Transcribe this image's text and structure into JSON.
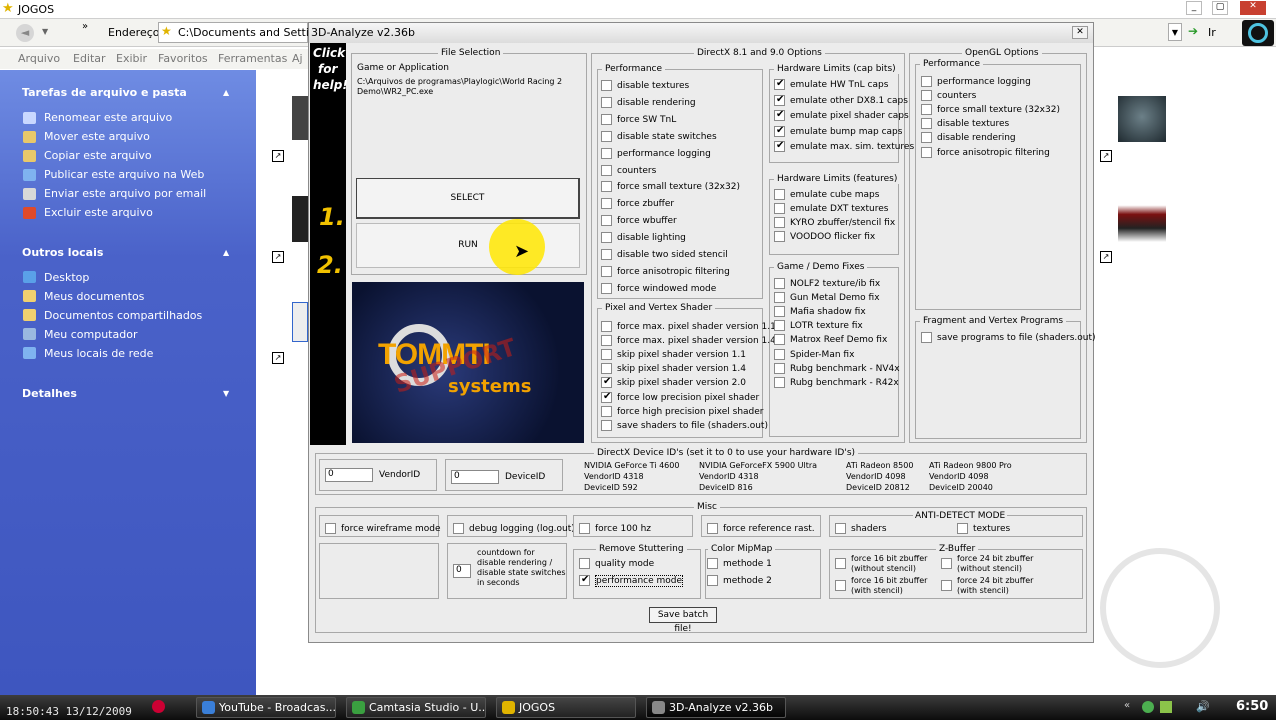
{
  "explorer": {
    "title": "JOGOS",
    "address_label": "Endereço",
    "address_value": "C:\\Documents and Setting",
    "go_label": "Ir",
    "menu": [
      "Arquivo",
      "Editar",
      "Exibir",
      "Favoritos",
      "Ferramentas",
      "Aj"
    ],
    "sidebar": {
      "tasks_title": "Tarefas de arquivo e pasta",
      "tasks": [
        "Renomear este arquivo",
        "Mover este arquivo",
        "Copiar este arquivo",
        "Publicar este arquivo na Web",
        "Enviar este arquivo por email",
        "Excluir este arquivo"
      ],
      "places_title": "Outros locais",
      "places": [
        "Desktop",
        "Meus documentos",
        "Documentos compartilhados",
        "Meu computador",
        "Meus locais de rede"
      ],
      "details_title": "Detalhes"
    }
  },
  "dialog": {
    "title": "3D-Analyze v2.36b",
    "help_text": [
      "Click",
      "for",
      "help!"
    ],
    "step1": "1.",
    "step2": "2.",
    "file_selection": {
      "title": "File Selection",
      "label": "Game or Application",
      "path": "C:\\Arquivos de programas\\Playlogic\\World Racing 2 Demo\\WR2_PC.exe",
      "select_button": "SELECT",
      "run_button": "RUN"
    },
    "logo": {
      "brand": "TOMMTI",
      "sub": "systems",
      "stamp": "SUPPORT"
    },
    "directx": {
      "title": "DirectX 8.1 and 9.0 Options",
      "performance": {
        "title": "Performance",
        "items": [
          {
            "label": "disable textures",
            "checked": false
          },
          {
            "label": "disable rendering",
            "checked": false
          },
          {
            "label": "force SW TnL",
            "checked": false
          },
          {
            "label": "disable state switches",
            "checked": false
          },
          {
            "label": "performance logging",
            "checked": false
          },
          {
            "label": "counters",
            "checked": false
          },
          {
            "label": "force small texture (32x32)",
            "checked": false
          },
          {
            "label": "force zbuffer",
            "checked": false
          },
          {
            "label": "force wbuffer",
            "checked": false
          },
          {
            "label": "disable lighting",
            "checked": false
          },
          {
            "label": "disable two sided stencil",
            "checked": false
          },
          {
            "label": "force anisotropic filtering",
            "checked": false
          },
          {
            "label": "force windowed mode",
            "checked": false
          }
        ]
      },
      "pixel_vertex": {
        "title": "Pixel and Vertex Shader",
        "items": [
          {
            "label": "force max. pixel shader version 1.1",
            "checked": false
          },
          {
            "label": "force max. pixel shader version 1.4",
            "checked": false
          },
          {
            "label": "skip pixel shader version 1.1",
            "checked": false
          },
          {
            "label": "skip pixel shader version 1.4",
            "checked": false
          },
          {
            "label": "skip pixel shader version 2.0",
            "checked": true
          },
          {
            "label": "force low precision pixel shader",
            "checked": true
          },
          {
            "label": "force high precision pixel shader",
            "checked": false
          },
          {
            "label": "save shaders to file (shaders.out)",
            "checked": false
          }
        ]
      },
      "caps": {
        "title": "Hardware Limits (cap bits)",
        "items": [
          {
            "label": "emulate HW TnL caps",
            "checked": true
          },
          {
            "label": "emulate other DX8.1 caps",
            "checked": true
          },
          {
            "label": "emulate pixel shader caps",
            "checked": true
          },
          {
            "label": "emulate bump map caps",
            "checked": true
          },
          {
            "label": "emulate max. sim. textures",
            "checked": true
          }
        ]
      },
      "features": {
        "title": "Hardware Limits (features)",
        "items": [
          {
            "label": "emulate cube maps",
            "checked": false
          },
          {
            "label": "emulate DXT textures",
            "checked": false
          },
          {
            "label": "KYRO zbuffer/stencil fix",
            "checked": false
          },
          {
            "label": "VOODOO flicker fix",
            "checked": false
          }
        ]
      },
      "fixes": {
        "title": "Game / Demo Fixes",
        "items": [
          {
            "label": "NOLF2 texture/ib fix",
            "checked": false
          },
          {
            "label": "Gun Metal Demo fix",
            "checked": false
          },
          {
            "label": "Mafia shadow fix",
            "checked": false
          },
          {
            "label": "LOTR texture fix",
            "checked": false
          },
          {
            "label": "Matrox Reef Demo fix",
            "checked": false
          },
          {
            "label": "Spider-Man fix",
            "checked": false
          },
          {
            "label": "Rubg benchmark - NV4x",
            "checked": false
          },
          {
            "label": "Rubg benchmark - R42x",
            "checked": false
          }
        ]
      }
    },
    "opengl": {
      "title": "OpenGL Options",
      "performance": {
        "title": "Performance",
        "items": [
          {
            "label": "performance logging",
            "checked": false
          },
          {
            "label": "counters",
            "checked": false
          },
          {
            "label": "force small texture (32x32)",
            "checked": false
          },
          {
            "label": "disable textures",
            "checked": false
          },
          {
            "label": "disable rendering",
            "checked": false
          },
          {
            "label": "force anisotropic filtering",
            "checked": false
          }
        ]
      },
      "fvp": {
        "title": "Fragment and Vertex Programs",
        "items": [
          {
            "label": "save programs to file (shaders.out)",
            "checked": false
          }
        ]
      }
    },
    "device_ids": {
      "title": "DirectX Device ID's (set it to 0 to use your hardware ID's)",
      "vendor_value": "0",
      "vendor_label": "VendorID",
      "device_value": "0",
      "device_label": "DeviceID",
      "cards": [
        {
          "name": "NVIDIA GeForce Ti 4600",
          "vendor": "VendorID 4318",
          "device": "DeviceID 592"
        },
        {
          "name": "NVIDIA GeForceFX 5900 Ultra",
          "vendor": "VendorID 4318",
          "device": "DeviceID 816"
        },
        {
          "name": "ATi Radeon 8500",
          "vendor": "VendorID 4098",
          "device": "DeviceID 20812"
        },
        {
          "name": "ATi Radeon 9800 Pro",
          "vendor": "VendorID 4098",
          "device": "DeviceID 20040"
        }
      ]
    },
    "misc": {
      "title": "Misc",
      "force_wireframe": "force wireframe mode",
      "debug_logging": "debug logging (log.out)",
      "force_100hz": "force 100 hz",
      "force_reference": "force reference rast.",
      "anti_detect_title": "ANTI-DETECT MODE",
      "shaders": "shaders",
      "textures": "textures",
      "countdown_value": "0",
      "countdown_label": [
        "countdown for",
        "disable rendering /",
        "disable state switches",
        "in seconds"
      ],
      "stutter_title": "Remove Stuttering",
      "quality_mode": {
        "label": "quality mode",
        "checked": false
      },
      "performance_mode": {
        "label": "performance mode",
        "checked": true
      },
      "mipmap_title": "Color MipMap",
      "methode1": "methode 1",
      "methode2": "methode 2",
      "zbuffer_title": "Z-Buffer",
      "z16_nostencil": [
        "force 16 bit zbuffer",
        "(without stencil)"
      ],
      "z16_stencil": [
        "force 16 bit zbuffer",
        "(with stencil)"
      ],
      "z24_nostencil": [
        "force 24 bit zbuffer",
        "(without stencil)"
      ],
      "z24_stencil": [
        "force 24 bit zbuffer",
        "(with stencil)"
      ],
      "save_batch": "Save batch file!"
    }
  },
  "taskbar": {
    "timestamp": "18:50:43 13/12/2009",
    "buttons": [
      "YouTube - Broadcas...",
      "Camtasia Studio - U...",
      "JOGOS",
      "3D-Analyze v2.36b"
    ],
    "clock": "6:50"
  },
  "colors": {
    "sidebar": "#4a62c9",
    "step_numbers": "#f2c200",
    "logo_orange": "#f2a200",
    "logo_bg": "#111a3a",
    "cursor_highlight": "#ffe600"
  }
}
